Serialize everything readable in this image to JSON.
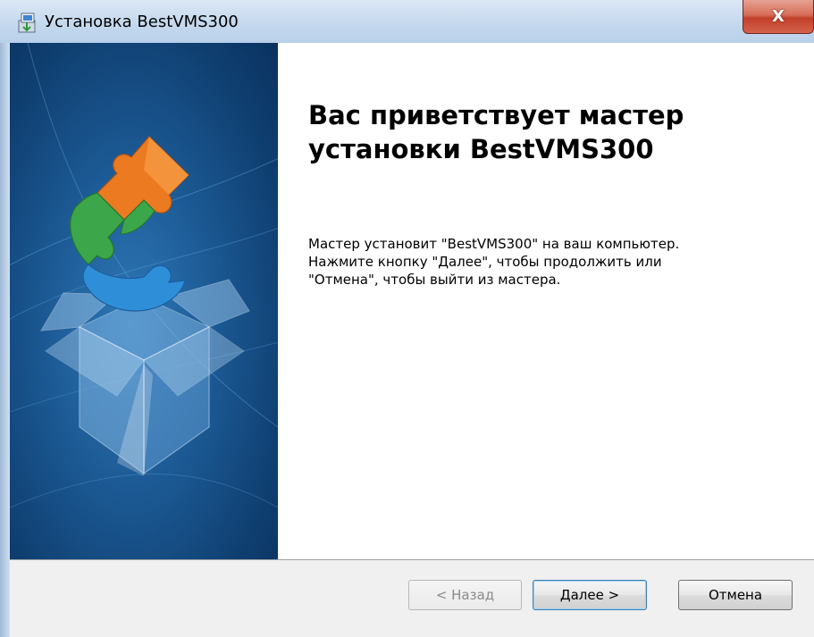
{
  "window": {
    "title": "Установка BestVMS300",
    "close_glyph": "X"
  },
  "welcome": {
    "title_lines": [
      "Вас приветствует мастер",
      "установки BestVMS300"
    ],
    "body_lines": [
      "Мастер установит \"BestVMS300\" на ваш компьютер.",
      "Нажмите кнопку \"Далее\", чтобы продолжить или",
      "\"Отмена\", чтобы выйти из мастера."
    ]
  },
  "buttons": {
    "back": "< Назад",
    "next": "Далее >",
    "cancel": "Отмена"
  },
  "icons": {
    "app": "installer-icon",
    "close": "close-icon",
    "banner": "puzzle-box-illustration"
  },
  "colors": {
    "close_button": "#c2402a",
    "banner_blue": "#1c5a95",
    "puzzle_orange": "#e8761e",
    "puzzle_green": "#3aa04a",
    "puzzle_blue": "#2f8fd6"
  }
}
